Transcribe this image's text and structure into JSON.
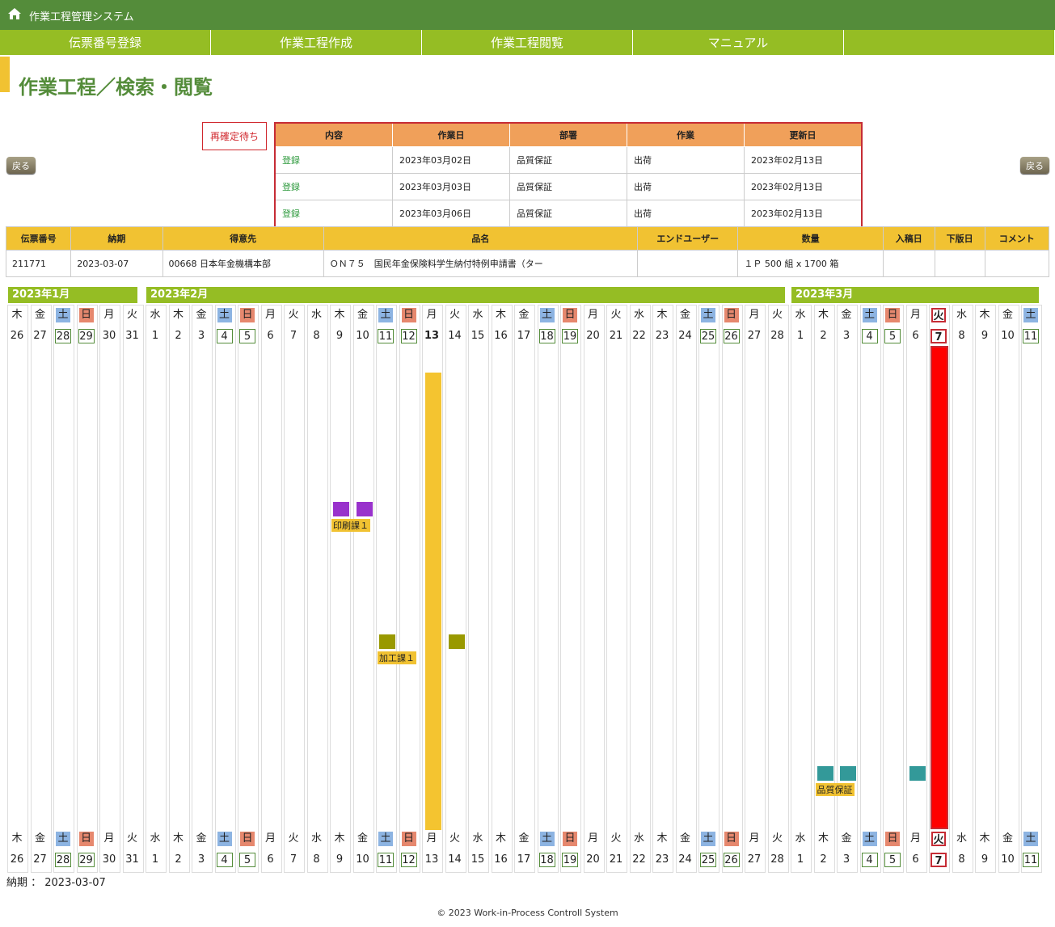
{
  "app": {
    "title": "作業工程管理システム"
  },
  "nav": [
    "伝票番号登録",
    "作業工程作成",
    "作業工程閲覧",
    "マニュアル"
  ],
  "page": {
    "title": "作業工程／検索・閲覧",
    "back_label": "戻る",
    "badge": "再確定待ち"
  },
  "pending": {
    "headers": [
      "内容",
      "作業日",
      "部署",
      "作業",
      "更新日"
    ],
    "rows": [
      [
        "登録",
        "2023年03月02日",
        "品質保証",
        "出荷",
        "2023年02月13日"
      ],
      [
        "登録",
        "2023年03月03日",
        "品質保証",
        "出荷",
        "2023年02月13日"
      ],
      [
        "登録",
        "2023年03月06日",
        "品質保証",
        "出荷",
        "2023年02月13日"
      ]
    ]
  },
  "info": {
    "headers": [
      "伝票番号",
      "納期",
      "得意先",
      "品名",
      "エンドユーザー",
      "数量",
      "入稿日",
      "下版日",
      "コメント"
    ],
    "row": [
      "211771",
      "2023-03-07",
      "00668 日本年金機構本部",
      "ＯＮ７５　国民年金保険料学生納付特例申請書（ター",
      "",
      "１Ｐ 500 組 x 1700 箱",
      "",
      "",
      ""
    ]
  },
  "calendar": {
    "months": [
      "2023年1月",
      "2023年2月",
      "2023年3月"
    ],
    "weekdays": [
      "木",
      "金",
      "土",
      "日",
      "月",
      "火",
      "水",
      "木",
      "金",
      "土",
      "日",
      "月",
      "火",
      "水",
      "木",
      "金",
      "土",
      "日",
      "月",
      "火",
      "水",
      "木",
      "金",
      "土",
      "日",
      "月",
      "火",
      "水",
      "木",
      "金",
      "土",
      "日",
      "月",
      "火",
      "水",
      "木",
      "金",
      "土",
      "日",
      "月",
      "火",
      "水",
      "木",
      "金",
      "土"
    ],
    "days": [
      "26",
      "27",
      "28",
      "29",
      "30",
      "31",
      "1",
      "2",
      "3",
      "4",
      "5",
      "6",
      "7",
      "8",
      "9",
      "10",
      "11",
      "12",
      "13",
      "14",
      "15",
      "16",
      "17",
      "18",
      "19",
      "20",
      "21",
      "22",
      "23",
      "24",
      "25",
      "26",
      "27",
      "28",
      "1",
      "2",
      "3",
      "4",
      "5",
      "6",
      "7",
      "8",
      "9",
      "10",
      "11"
    ],
    "today_index": 40,
    "entry_index": 18,
    "colors": {
      "sat": "#8db4e2",
      "sun": "#e6886e",
      "today": "#ff0000",
      "entry": "#f4c430",
      "print": "#9932cc",
      "process": "#999900",
      "quality": "#339999"
    },
    "groups": [
      {
        "label": "印刷課１",
        "days": [
          14,
          15
        ],
        "color": "print"
      },
      {
        "label": "加工課１",
        "days": [
          16,
          19
        ],
        "color": "process"
      },
      {
        "label": "品質保証",
        "days": [
          35,
          36,
          39
        ],
        "color": "quality"
      }
    ]
  },
  "due": "納期 ： 2023-03-07",
  "footer": "© 2023 Work-in-Process Controll System"
}
